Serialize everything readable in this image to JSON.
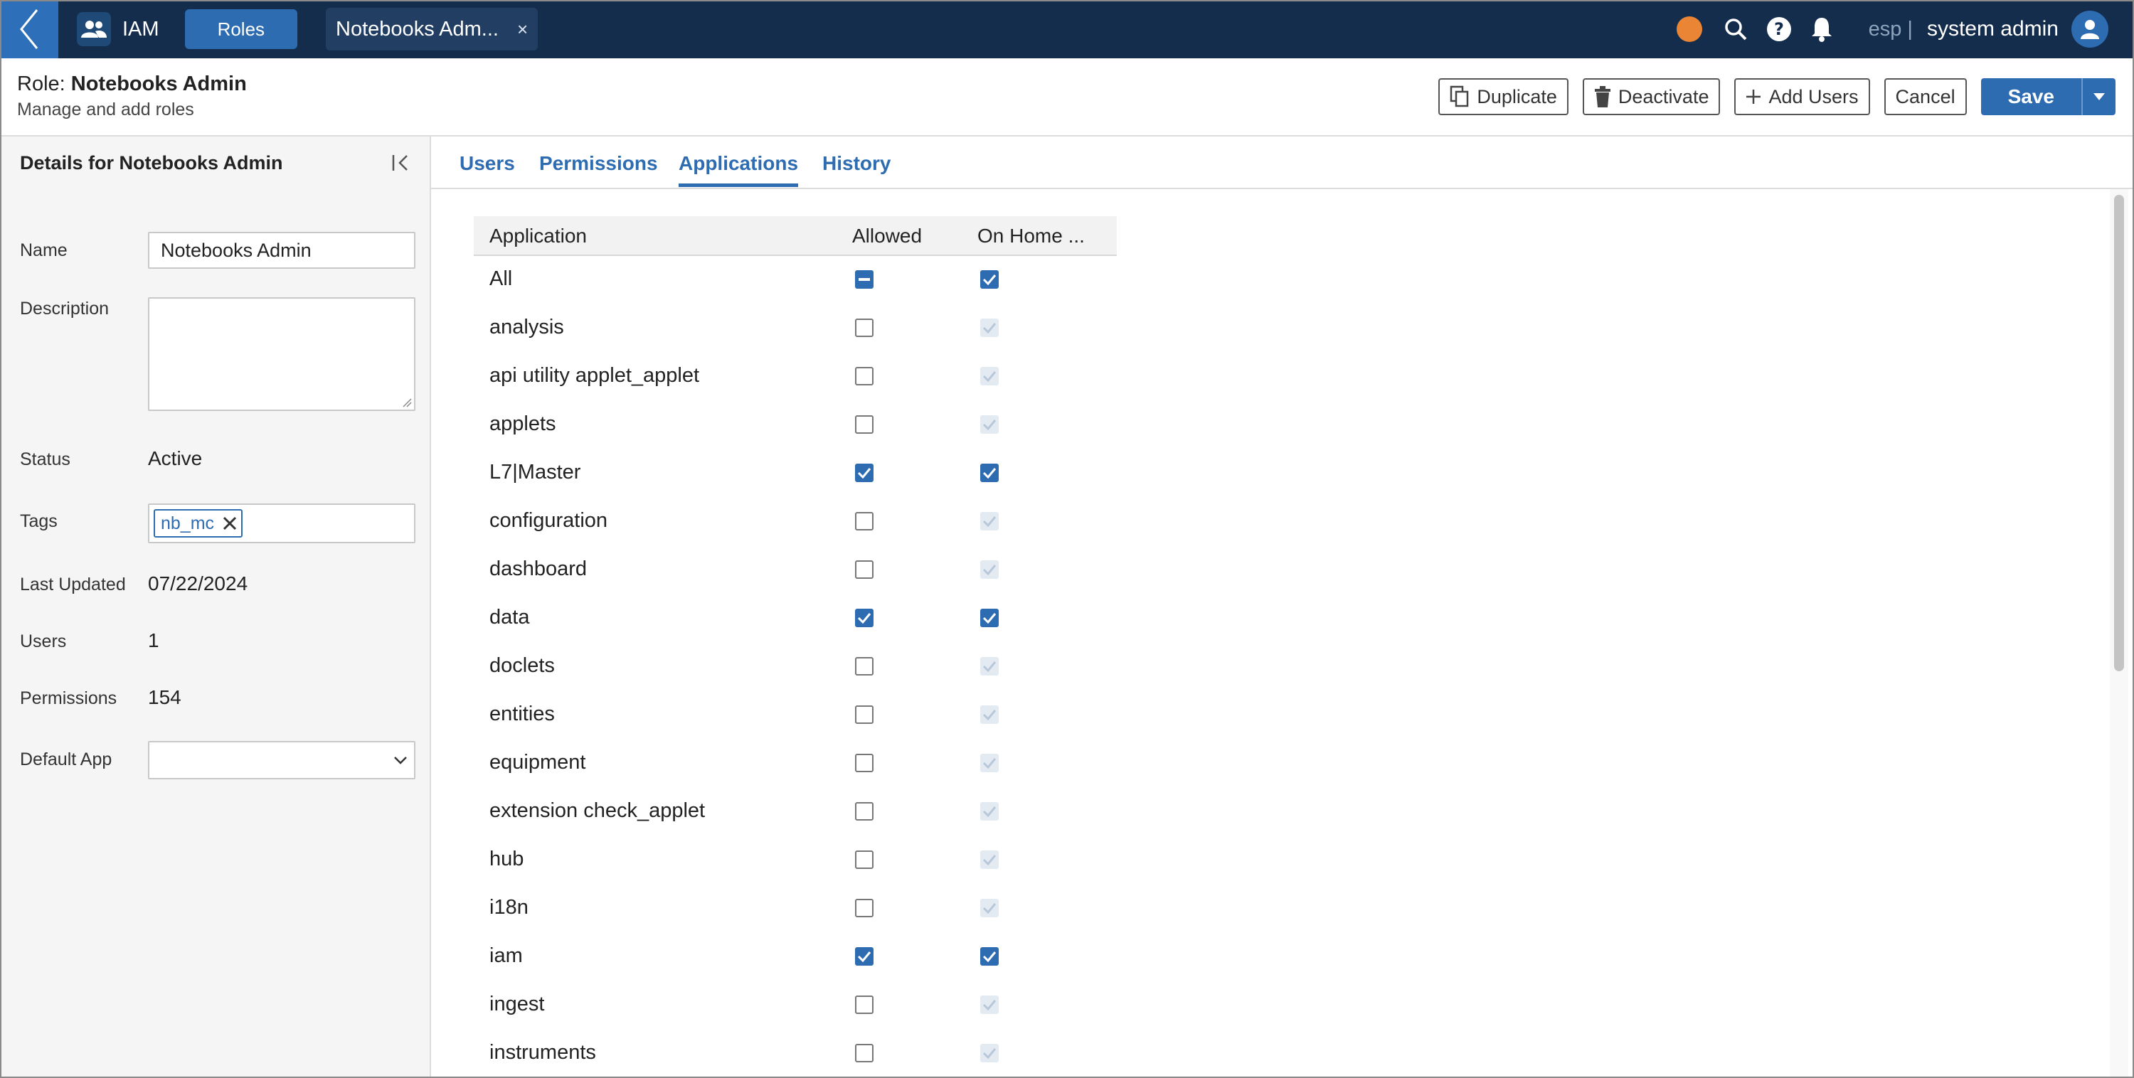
{
  "topbar": {
    "app_label": "IAM",
    "roles_label": "Roles",
    "doc_tab_label": "Notebooks Adm...",
    "doc_tab_close": "×",
    "lang": "esp |",
    "user": "system admin",
    "status_color": "#e98534"
  },
  "header": {
    "role_prefix": "Role: ",
    "role_name": "Notebooks Admin",
    "subtitle": "Manage and add roles",
    "duplicate": "Duplicate",
    "deactivate": "Deactivate",
    "add_users": "Add Users",
    "cancel": "Cancel",
    "save": "Save"
  },
  "details": {
    "title": "Details for Notebooks Admin",
    "name_label": "Name",
    "name_value": "Notebooks Admin",
    "description_label": "Description",
    "description_value": "",
    "status_label": "Status",
    "status_value": "Active",
    "tags_label": "Tags",
    "tag": "nb_mc",
    "last_updated_label": "Last Updated",
    "last_updated_value": "07/22/2024",
    "users_label": "Users",
    "users_value": "1",
    "permissions_label": "Permissions",
    "permissions_value": "154",
    "default_app_label": "Default App",
    "default_app_value": ""
  },
  "tabs": [
    "Users",
    "Permissions",
    "Applications",
    "History"
  ],
  "active_tab": "Applications",
  "table": {
    "columns": [
      "Application",
      "Allowed",
      "On Home ..."
    ],
    "rows": [
      {
        "name": "All",
        "allowed": "indeterminate",
        "home": "checked"
      },
      {
        "name": "analysis",
        "allowed": "unchecked",
        "home": "disabled"
      },
      {
        "name": "api utility applet_applet",
        "allowed": "unchecked",
        "home": "disabled"
      },
      {
        "name": "applets",
        "allowed": "unchecked",
        "home": "disabled"
      },
      {
        "name": "L7|Master",
        "allowed": "checked",
        "home": "checked"
      },
      {
        "name": "configuration",
        "allowed": "unchecked",
        "home": "disabled"
      },
      {
        "name": "dashboard",
        "allowed": "unchecked",
        "home": "disabled"
      },
      {
        "name": "data",
        "allowed": "checked",
        "home": "checked"
      },
      {
        "name": "doclets",
        "allowed": "unchecked",
        "home": "disabled"
      },
      {
        "name": "entities",
        "allowed": "unchecked",
        "home": "disabled"
      },
      {
        "name": "equipment",
        "allowed": "unchecked",
        "home": "disabled"
      },
      {
        "name": "extension check_applet",
        "allowed": "unchecked",
        "home": "disabled"
      },
      {
        "name": "hub",
        "allowed": "unchecked",
        "home": "disabled"
      },
      {
        "name": "i18n",
        "allowed": "unchecked",
        "home": "disabled"
      },
      {
        "name": "iam",
        "allowed": "checked",
        "home": "checked"
      },
      {
        "name": "ingest",
        "allowed": "unchecked",
        "home": "disabled"
      },
      {
        "name": "instruments",
        "allowed": "unchecked",
        "home": "disabled"
      }
    ]
  },
  "colors": {
    "nav": "#142d4c",
    "accent": "#2e6cb2",
    "disabled_check": "#e3eaf2"
  }
}
